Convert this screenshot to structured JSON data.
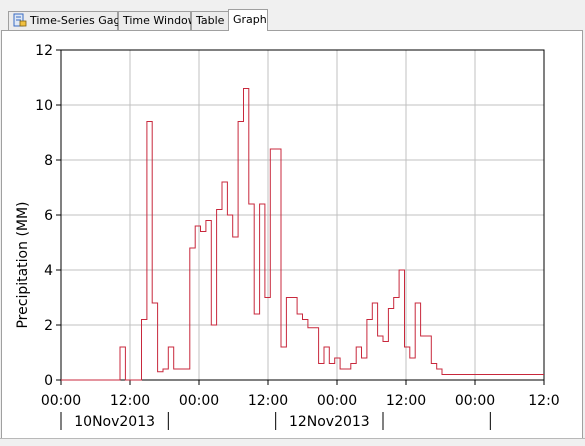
{
  "tabs": [
    {
      "label": "Time-Series Gage",
      "icon": "gage-icon"
    },
    {
      "label": "Time Window"
    },
    {
      "label": "Table"
    },
    {
      "label": "Graph",
      "active": true
    }
  ],
  "chart_data": {
    "type": "line",
    "step": true,
    "ylabel": "Precipitation (MM)",
    "ylim": [
      0,
      12
    ],
    "y_ticks": [
      "0",
      "2",
      "4",
      "6",
      "8",
      "10",
      "12"
    ],
    "x_hours_range": [
      0,
      54
    ],
    "x_tick_labels": [
      "00:00",
      "12:00",
      "00:00",
      "12:00",
      "00:00",
      "12:00",
      "00:00",
      "12:0"
    ],
    "date_labels": [
      "10Nov2013",
      "12Nov2013"
    ],
    "grid": true,
    "color": "#c8283c",
    "series": [
      {
        "x": [
          0,
          6.6,
          7.2,
          9.0,
          9.6,
          10.2,
          10.8,
          11.4,
          12.0,
          12.6,
          14.4,
          15.0,
          15.6,
          16.2,
          16.8,
          17.4,
          18.0,
          18.6,
          19.2,
          19.8,
          20.4,
          21.0,
          21.6,
          22.2,
          22.8,
          23.4,
          24.6,
          25.2,
          25.8,
          26.4,
          27.0,
          27.6,
          28.8,
          29.4,
          30.0,
          30.6,
          31.2,
          32.4,
          33.0,
          33.6,
          34.2,
          34.8,
          35.4,
          36.0,
          36.6,
          37.2,
          37.8,
          38.4,
          39.0,
          39.6,
          40.2,
          40.8,
          41.4,
          42.0,
          42.6,
          43.2,
          44.4,
          45.0,
          54
        ],
        "values": [
          0,
          1.2,
          0,
          2.2,
          9.4,
          2.8,
          0.3,
          0.4,
          1.2,
          0.4,
          4.8,
          5.6,
          5.4,
          5.8,
          2.0,
          6.2,
          7.2,
          6.0,
          5.2,
          9.4,
          10.6,
          6.4,
          2.4,
          6.4,
          3.0,
          8.4,
          1.2,
          3.0,
          3.0,
          2.4,
          2.2,
          1.9,
          0.6,
          1.2,
          0.6,
          0.8,
          0.4,
          0.6,
          1.2,
          0.8,
          2.2,
          2.8,
          1.6,
          1.4,
          2.6,
          3.0,
          4.0,
          1.2,
          0.8,
          2.8,
          1.6,
          1.6,
          0.6,
          0.4,
          0.2,
          0.2,
          0.2,
          0.2,
          0
        ]
      }
    ]
  }
}
